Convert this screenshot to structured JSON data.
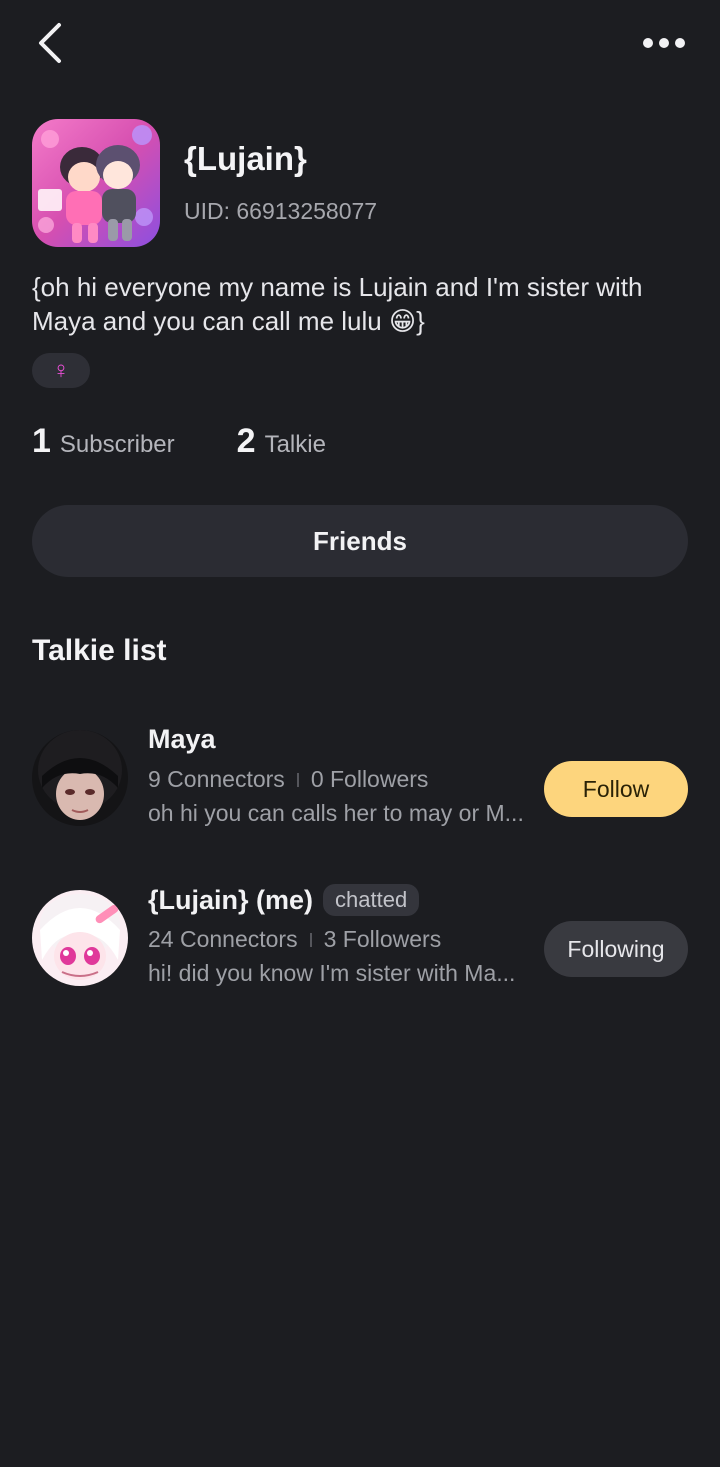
{
  "header": {
    "back_icon": "chevron-left-icon",
    "more_icon": "more-horizontal-icon"
  },
  "profile": {
    "name": "{Lujain}",
    "uid": "UID: 66913258077",
    "bio": "{oh hi everyone my name is Lujain and I'm sister with Maya and you can call me lulu 😁}",
    "gender_symbol": "♀",
    "gender_color": "#e94fd6",
    "stats": [
      {
        "value": "1",
        "label": "Subscriber"
      },
      {
        "value": "2",
        "label": "Talkie"
      }
    ]
  },
  "friends_button": {
    "label": "Friends"
  },
  "talkie_list": {
    "title": "Talkie list",
    "items": [
      {
        "name": "Maya",
        "badge": "",
        "connectors": "9 Connectors",
        "followers": "0 Followers",
        "description": "oh hi you can calls her to may or M...",
        "action": "Follow"
      },
      {
        "name": "{Lujain} (me)",
        "badge": "chatted",
        "connectors": "24 Connectors",
        "followers": "3 Followers",
        "description": "hi! did you know I'm sister with Ma...",
        "action": "Following"
      }
    ]
  },
  "colors": {
    "background": "#1c1d21",
    "follow_accent": "#fdd57d",
    "following_bg": "#393a40"
  }
}
